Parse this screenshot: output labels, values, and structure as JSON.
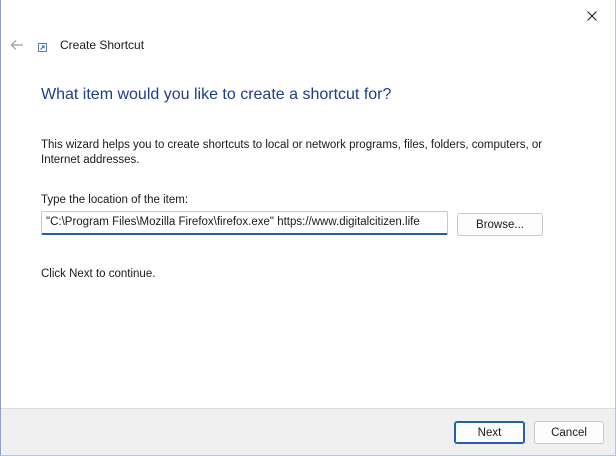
{
  "window": {
    "close_icon": "close-icon"
  },
  "header": {
    "back_icon": "back-arrow-icon",
    "app_icon": "shortcut-icon",
    "title": "Create Shortcut"
  },
  "main": {
    "heading": "What item would you like to create a shortcut for?",
    "description": "This wizard helps you to create shortcuts to local or network programs, files, folders, computers, or Internet addresses.",
    "location_label": "Type the location of the item:",
    "location_value": "\"C:\\Program Files\\Mozilla Firefox\\firefox.exe\" https://www.digitalcitizen.life",
    "browse_label": "Browse...",
    "continue_text": "Click Next to continue."
  },
  "footer": {
    "next_label": "Next",
    "cancel_label": "Cancel"
  },
  "colors": {
    "heading": "#1f3d8e",
    "accent": "#1f5fb8",
    "footer_bg": "#f0f0f0"
  }
}
